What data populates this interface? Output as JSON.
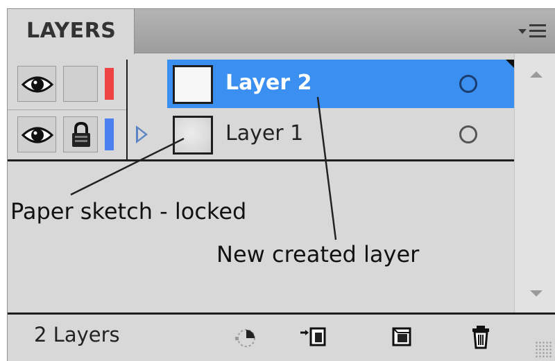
{
  "panel": {
    "tab_label": "LAYERS",
    "menu_icon": "panel-menu-icon"
  },
  "layers": [
    {
      "name": "Layer 2",
      "visible": true,
      "locked": false,
      "selected": true,
      "color": "#ee4444",
      "expandable": false
    },
    {
      "name": "Layer 1",
      "visible": true,
      "locked": true,
      "selected": false,
      "color": "#4c7ff0",
      "expandable": true
    }
  ],
  "footer": {
    "count_label": "2 Layers",
    "buttons": [
      "make-clipping-mask-icon",
      "create-sublayer-icon",
      "create-new-layer-icon",
      "delete-layer-icon"
    ]
  },
  "annotations": {
    "locked_note": "Paper sketch - locked",
    "new_note": "New created layer"
  },
  "colors": {
    "selection": "#3a8ff0",
    "panel_bg": "#d8d8d8"
  }
}
